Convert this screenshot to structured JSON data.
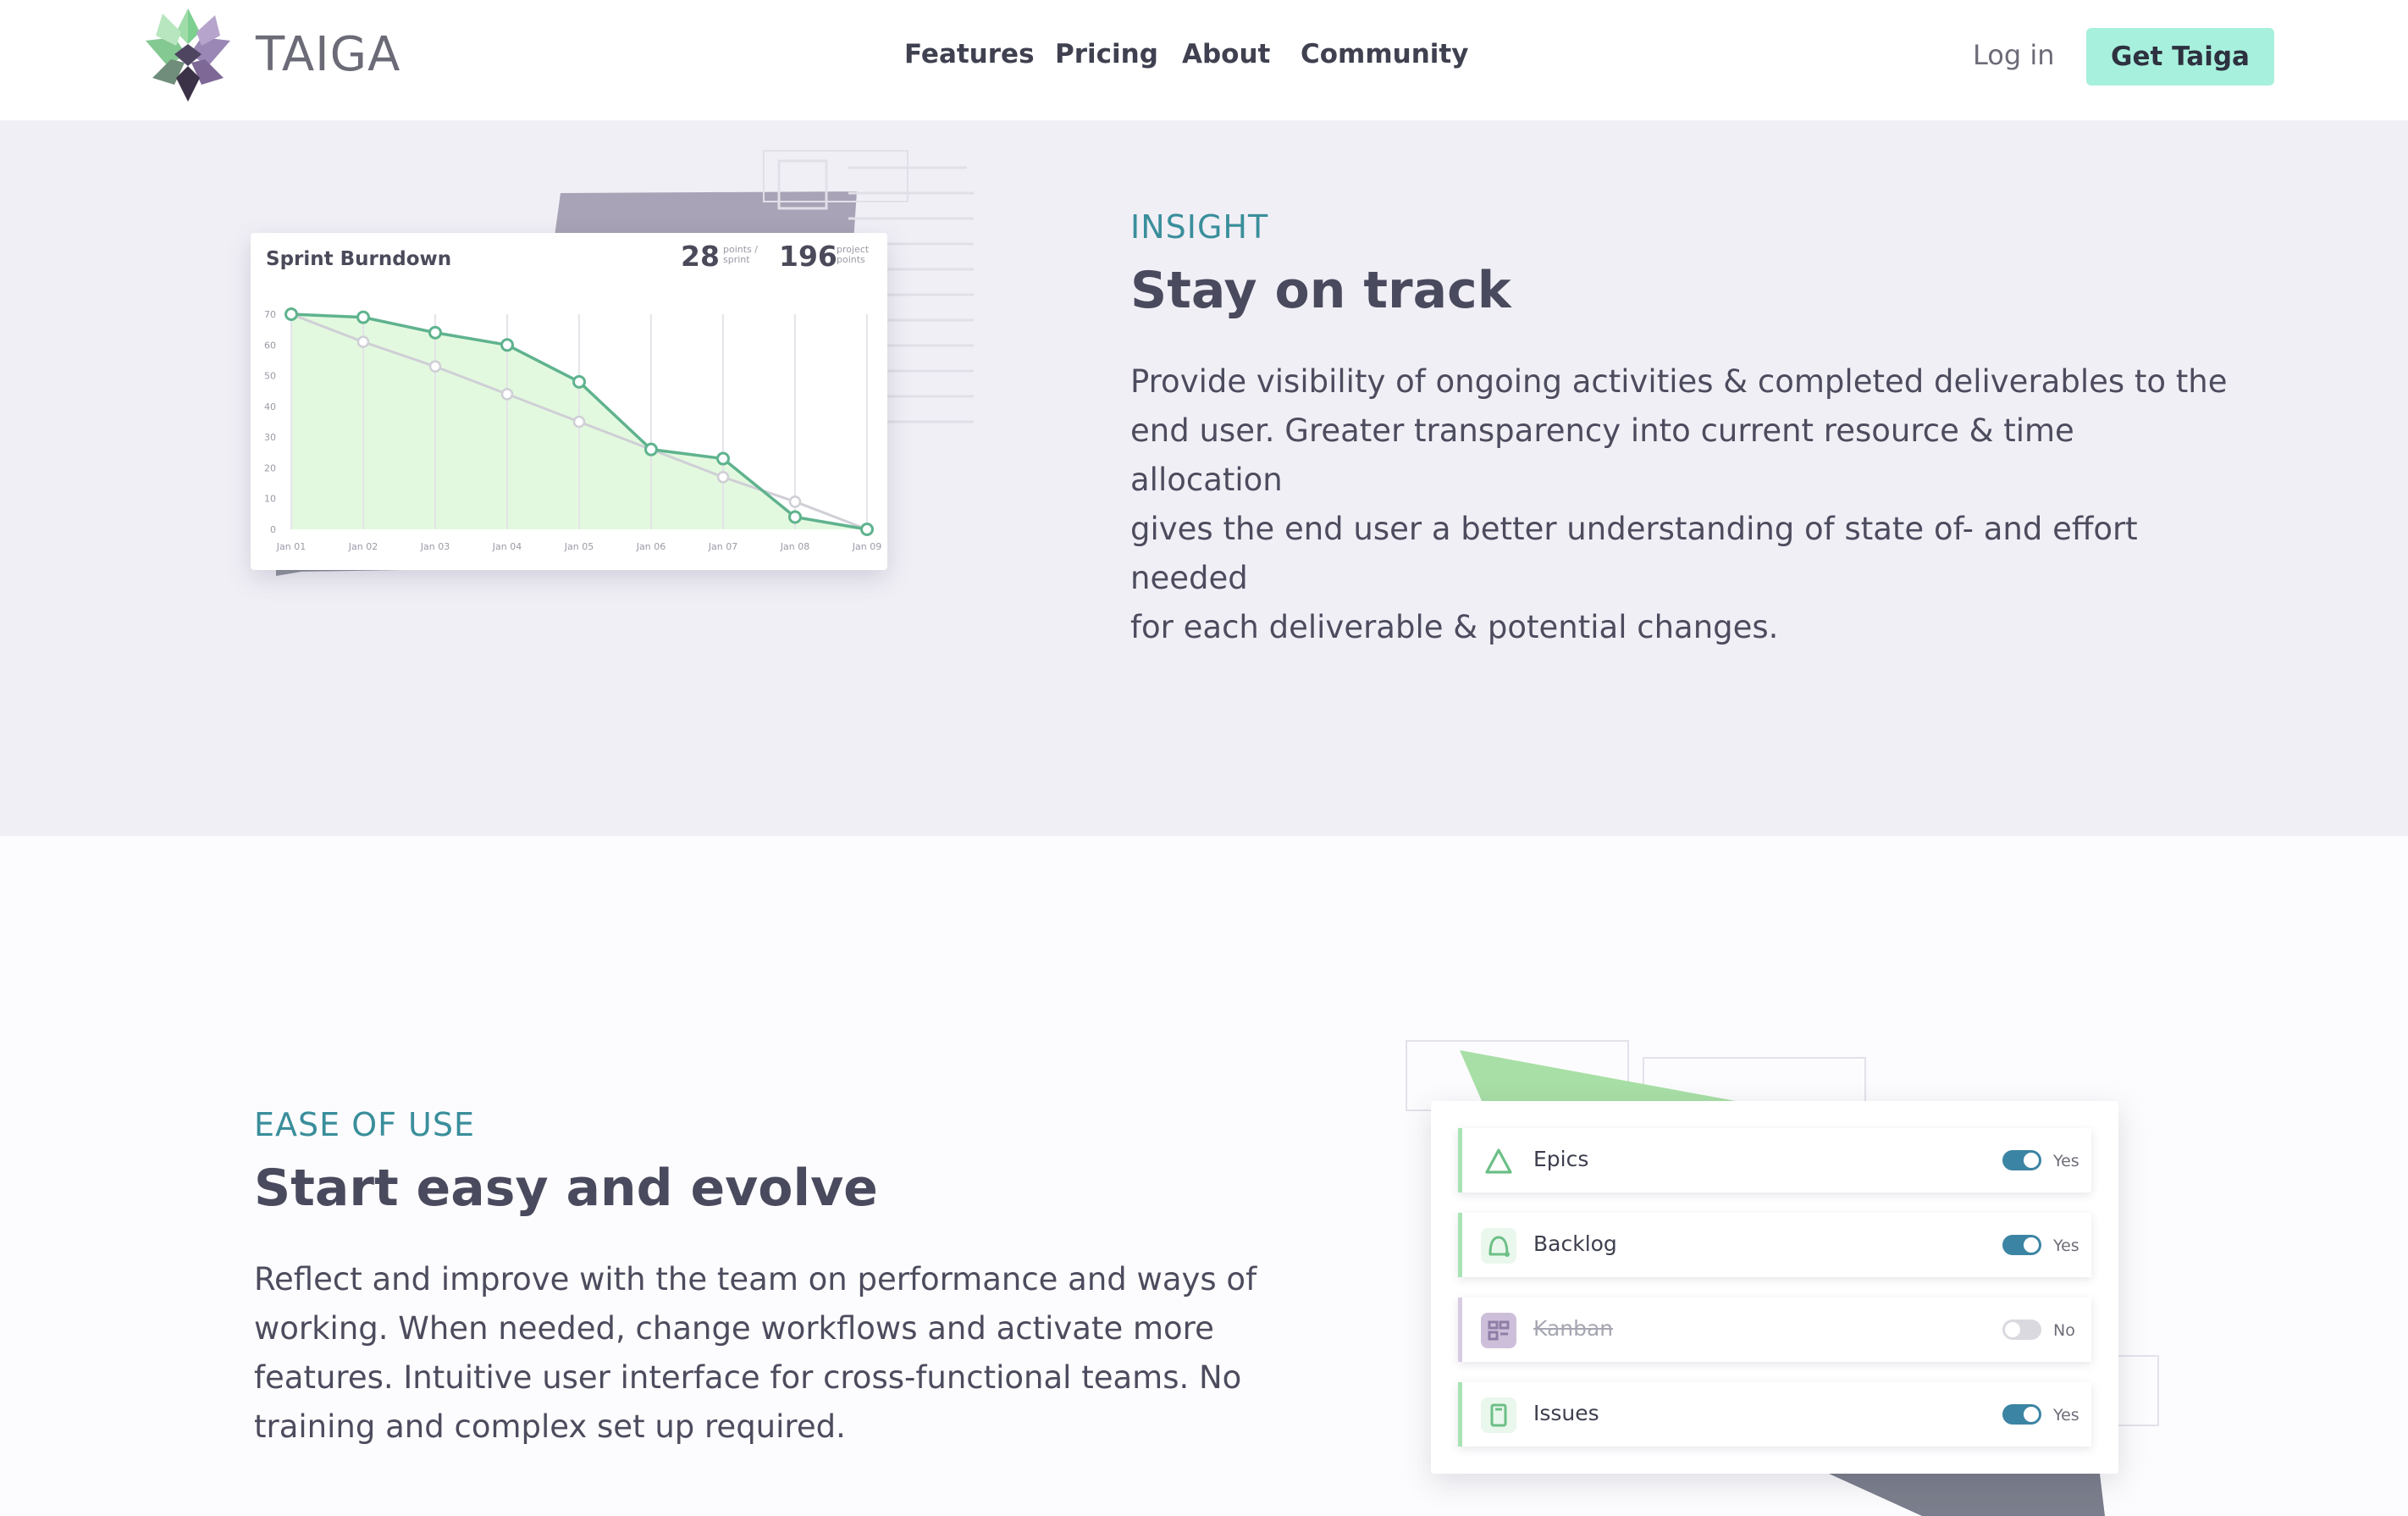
{
  "header": {
    "logo_text": "TAIGA",
    "nav": [
      "Features",
      "Pricing",
      "About",
      "Community"
    ],
    "login_label": "Log in",
    "cta_label": "Get Taiga"
  },
  "insight": {
    "eyebrow": "INSIGHT",
    "title": "Stay on track",
    "body_lines": [
      "Provide visibility of ongoing activities & completed deliverables to the",
      "end user. Greater transparency into current resource & time allocation",
      "gives the end user a better understanding of state of- and effort needed",
      "for each deliverable & potential changes."
    ]
  },
  "burndown": {
    "title": "Sprint Burndown",
    "points_per_sprint": "28",
    "points_per_sprint_label": [
      "points /",
      "sprint"
    ],
    "project_points": "196",
    "project_points_label": [
      "project",
      "points"
    ]
  },
  "chart_data": {
    "type": "line",
    "title": "Sprint Burndown",
    "categories": [
      "Jan 01",
      "Jan 02",
      "Jan 03",
      "Jan 04",
      "Jan 05",
      "Jan 06",
      "Jan 07",
      "Jan 08",
      "Jan 09"
    ],
    "yticks": [
      0,
      10,
      20,
      30,
      40,
      50,
      60,
      70
    ],
    "ylim": [
      0,
      70
    ],
    "series": [
      {
        "values": [
          70,
          69,
          64,
          60,
          48,
          26,
          23,
          4,
          0
        ]
      },
      {
        "values": [
          70,
          61,
          53,
          44,
          35,
          26,
          17,
          9,
          0
        ]
      }
    ],
    "colors": {
      "actual": "#5fb38e",
      "ideal": "#cfcfd6",
      "fill": "#e3f9df"
    }
  },
  "ease": {
    "eyebrow": "EASE OF USE",
    "title": "Start easy and evolve",
    "body_lines": [
      "Reflect and improve with the team on performance and ways of",
      "working. When needed, change workflows and activate more",
      "features. Intuitive user interface for cross-functional teams. No",
      "training and complex set up required."
    ]
  },
  "settings": [
    {
      "label": "Epics",
      "value": "Yes",
      "on": true,
      "icon": "epics-triangle-icon"
    },
    {
      "label": "Backlog",
      "value": "Yes",
      "on": true,
      "icon": "backlog-icon"
    },
    {
      "label": "Kanban",
      "value": "No",
      "on": false,
      "icon": "kanban-board-icon"
    },
    {
      "label": "Issues",
      "value": "Yes",
      "on": true,
      "icon": "issues-icon"
    }
  ],
  "colors": {
    "accent_text": "#3a8e9b",
    "cta_bg": "#a7f0dd",
    "section_bg": "#f1eff6",
    "toggle_on": "#3c84a3"
  }
}
